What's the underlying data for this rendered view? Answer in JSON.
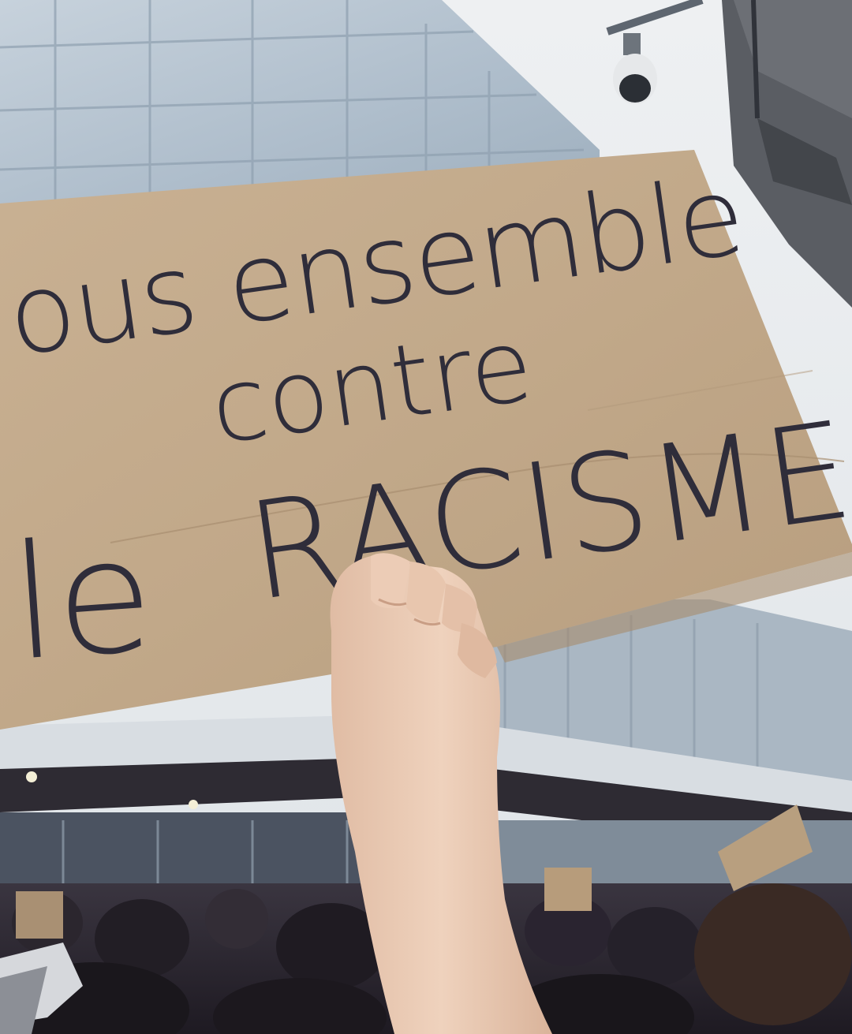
{
  "photo": {
    "subject": "protest-sign",
    "sign": {
      "line1": "ous ensemble",
      "line2": "contre",
      "line3_small": "le",
      "line3_large": "RACISME"
    },
    "colors": {
      "sky": "#e9ecef",
      "building_glass": "#b9c6d2",
      "cardboard": "#c4ab8d",
      "ink": "#2f2d3a",
      "skin": "#e9c9b2",
      "crowd": "#2a2530"
    }
  }
}
